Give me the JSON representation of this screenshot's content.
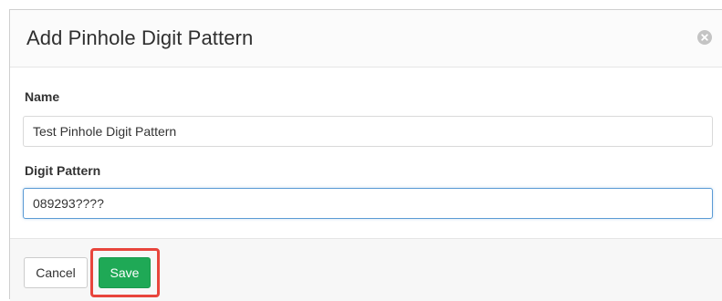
{
  "dialog": {
    "title": "Add Pinhole Digit Pattern",
    "close_icon": "close-circle-icon"
  },
  "form": {
    "name_label": "Name",
    "name_value": "Test Pinhole Digit Pattern",
    "pattern_label": "Digit Pattern",
    "pattern_value": "089293????"
  },
  "footer": {
    "cancel_label": "Cancel",
    "save_label": "Save"
  },
  "colors": {
    "save_button": "#1fa956",
    "highlight": "#e8453c",
    "focus_border": "#5b9bd5"
  }
}
